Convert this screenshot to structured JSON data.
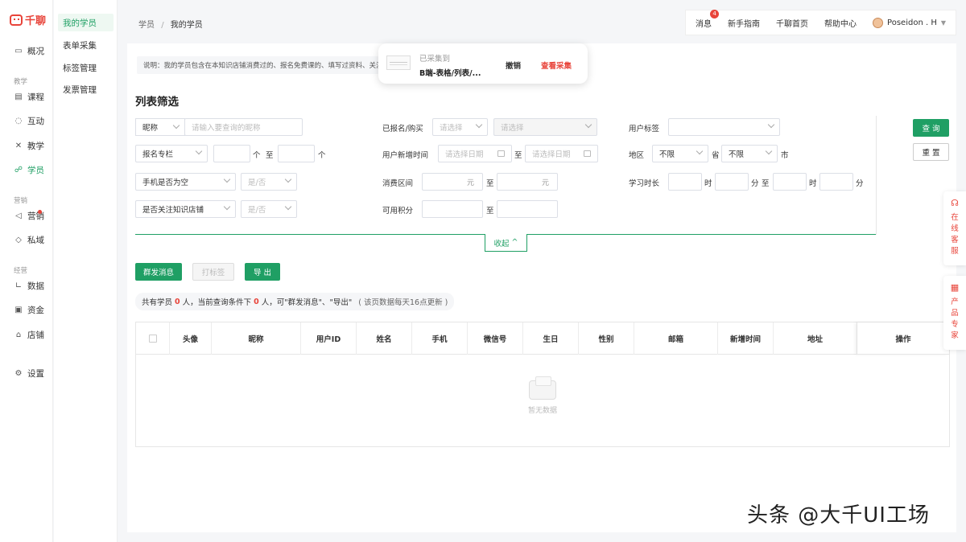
{
  "app": {
    "logo_text": "千聊"
  },
  "nav": {
    "items": [
      {
        "label": "概况",
        "icon": "monitor-icon"
      },
      {
        "label": "课程",
        "icon": "book-icon"
      },
      {
        "label": "互动",
        "icon": "chat-icon"
      },
      {
        "label": "教学",
        "icon": "tools-icon"
      },
      {
        "label": "学员",
        "icon": "users-icon"
      },
      {
        "label": "营销",
        "icon": "megaphone-icon"
      },
      {
        "label": "私域",
        "icon": "shield-icon"
      },
      {
        "label": "数据",
        "icon": "chart-icon"
      },
      {
        "label": "资金",
        "icon": "wallet-icon"
      },
      {
        "label": "店铺",
        "icon": "store-icon"
      },
      {
        "label": "设置",
        "icon": "gear-icon"
      }
    ],
    "groups": [
      "教学",
      "营销",
      "经营"
    ],
    "active": "学员"
  },
  "subnav": {
    "items": [
      "我的学员",
      "表单采集",
      "标签管理",
      "发票管理"
    ],
    "active": "我的学员"
  },
  "breadcrumb": {
    "parent": "学员",
    "sep": "/",
    "current": "我的学员"
  },
  "topbar": {
    "messages": "消息",
    "message_count": "4",
    "guide": "新手指南",
    "home": "千聊首页",
    "help": "帮助中心",
    "user": "Poseidon . H"
  },
  "notice": "说明：我的学员包含在本知识店铺消费过的、报名免费课的、填写过资料、关注过",
  "toast": {
    "title": "已采集到",
    "name": "B端-表格/列表/...",
    "undo": "撤销",
    "view": "查看采集"
  },
  "filters": {
    "title": "列表筛选",
    "nickname_select": "昵称",
    "nickname_placeholder": "请输入要查询的昵称",
    "column_select": "报名专栏",
    "unit_ge": "个",
    "to": "至",
    "phone_empty_select": "手机是否为空",
    "yes_no": "是/否",
    "follow_select": "是否关注知识店铺",
    "signed_label": "已报名/购买",
    "please_select": "请选择",
    "new_time_label": "用户新增时间",
    "date_placeholder": "请选择日期",
    "spend_label": "消费区间",
    "yuan": "元",
    "points_label": "可用积分",
    "tag_label": "用户标签",
    "region_label": "地区",
    "unlimited": "不限",
    "province": "省",
    "city": "市",
    "study_label": "学习时长",
    "hour": "时",
    "minute": "分",
    "query": "查 询",
    "reset": "重 置",
    "collapse": "收起"
  },
  "actions": {
    "bulk_message": "群发消息",
    "tag": "打标签",
    "export": "导 出"
  },
  "summary": {
    "prefix": "共有学员",
    "total": "0",
    "mid": "人，当前查询条件下",
    "current": "0",
    "suffix": "人，可\"群发消息\"、\"导出\"",
    "hint": "( 该页数据每天16点更新 )"
  },
  "table": {
    "columns": [
      "头像",
      "昵称",
      "用户ID",
      "姓名",
      "手机",
      "微信号",
      "生日",
      "性别",
      "邮箱",
      "新增时间",
      "地址",
      "操作"
    ],
    "empty_text": "暂无数据"
  },
  "float": {
    "service": "在线客服",
    "expert": "产品专家"
  },
  "watermark": "头条 @大千UI工场"
}
